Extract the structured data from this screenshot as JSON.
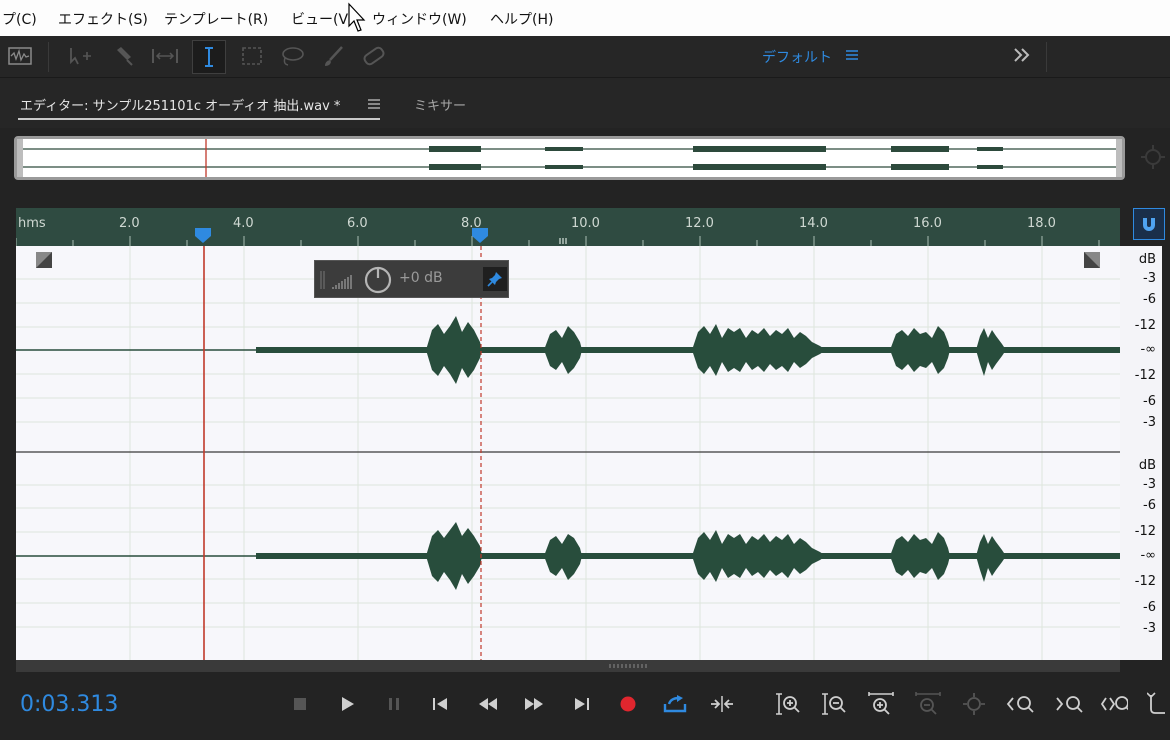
{
  "menu": [
    "プ(C)",
    "エフェクト(S)",
    "テンプレート(R)",
    "ビュー(V)",
    "ウィンドウ(W)",
    "ヘルプ(H)"
  ],
  "workspace": {
    "label": "デフォルト"
  },
  "tabs": {
    "editor_label": "エディター: サンプル251101c オーディオ 抽出.wav *",
    "mixer_label": "ミキサー"
  },
  "ruler": {
    "unit": "hms",
    "labels": [
      "2.0",
      "4.0",
      "6.0",
      "8.0",
      "10.0",
      "12.0",
      "14.0",
      "16.0",
      "18.0"
    ]
  },
  "gain": {
    "value": "+0 dB"
  },
  "db_scale": {
    "channel1": [
      "dB",
      "-3",
      "-6",
      "-12",
      "-∞",
      "-12",
      "-6",
      "-3"
    ],
    "channel2": [
      "dB",
      "-3",
      "-6",
      "-12",
      "-∞",
      "-12",
      "-6",
      "-3"
    ]
  },
  "transport": {
    "time": "0:03.313"
  },
  "colors": {
    "accent": "#2f8ae0",
    "waveform": "#284d3c",
    "ruler": "#2f4b41",
    "playhead": "#c0392b",
    "record": "#e0262e"
  }
}
